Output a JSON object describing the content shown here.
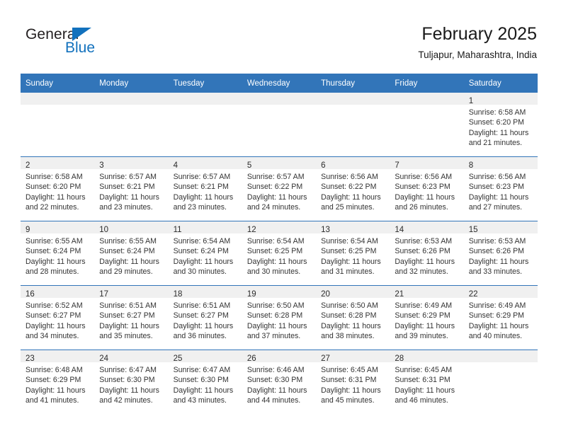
{
  "logo": {
    "word_one": "General",
    "word_two": "Blue",
    "triangle_icon": "triangle-icon",
    "accent_color": "#1271bd"
  },
  "header": {
    "title": "February 2025",
    "subtitle": "Tuljapur, Maharashtra, India",
    "header_bg_color": "#3275b9"
  },
  "calendar": {
    "weekday_headers": [
      "Sunday",
      "Monday",
      "Tuesday",
      "Wednesday",
      "Thursday",
      "Friday",
      "Saturday"
    ],
    "weeks": [
      [
        {
          "day": "",
          "lines": []
        },
        {
          "day": "",
          "lines": []
        },
        {
          "day": "",
          "lines": []
        },
        {
          "day": "",
          "lines": []
        },
        {
          "day": "",
          "lines": []
        },
        {
          "day": "",
          "lines": []
        },
        {
          "day": "1",
          "lines": [
            "Sunrise: 6:58 AM",
            "Sunset: 6:20 PM",
            "Daylight: 11 hours",
            "and 21 minutes."
          ]
        }
      ],
      [
        {
          "day": "2",
          "lines": [
            "Sunrise: 6:58 AM",
            "Sunset: 6:20 PM",
            "Daylight: 11 hours",
            "and 22 minutes."
          ]
        },
        {
          "day": "3",
          "lines": [
            "Sunrise: 6:57 AM",
            "Sunset: 6:21 PM",
            "Daylight: 11 hours",
            "and 23 minutes."
          ]
        },
        {
          "day": "4",
          "lines": [
            "Sunrise: 6:57 AM",
            "Sunset: 6:21 PM",
            "Daylight: 11 hours",
            "and 23 minutes."
          ]
        },
        {
          "day": "5",
          "lines": [
            "Sunrise: 6:57 AM",
            "Sunset: 6:22 PM",
            "Daylight: 11 hours",
            "and 24 minutes."
          ]
        },
        {
          "day": "6",
          "lines": [
            "Sunrise: 6:56 AM",
            "Sunset: 6:22 PM",
            "Daylight: 11 hours",
            "and 25 minutes."
          ]
        },
        {
          "day": "7",
          "lines": [
            "Sunrise: 6:56 AM",
            "Sunset: 6:23 PM",
            "Daylight: 11 hours",
            "and 26 minutes."
          ]
        },
        {
          "day": "8",
          "lines": [
            "Sunrise: 6:56 AM",
            "Sunset: 6:23 PM",
            "Daylight: 11 hours",
            "and 27 minutes."
          ]
        }
      ],
      [
        {
          "day": "9",
          "lines": [
            "Sunrise: 6:55 AM",
            "Sunset: 6:24 PM",
            "Daylight: 11 hours",
            "and 28 minutes."
          ]
        },
        {
          "day": "10",
          "lines": [
            "Sunrise: 6:55 AM",
            "Sunset: 6:24 PM",
            "Daylight: 11 hours",
            "and 29 minutes."
          ]
        },
        {
          "day": "11",
          "lines": [
            "Sunrise: 6:54 AM",
            "Sunset: 6:24 PM",
            "Daylight: 11 hours",
            "and 30 minutes."
          ]
        },
        {
          "day": "12",
          "lines": [
            "Sunrise: 6:54 AM",
            "Sunset: 6:25 PM",
            "Daylight: 11 hours",
            "and 30 minutes."
          ]
        },
        {
          "day": "13",
          "lines": [
            "Sunrise: 6:54 AM",
            "Sunset: 6:25 PM",
            "Daylight: 11 hours",
            "and 31 minutes."
          ]
        },
        {
          "day": "14",
          "lines": [
            "Sunrise: 6:53 AM",
            "Sunset: 6:26 PM",
            "Daylight: 11 hours",
            "and 32 minutes."
          ]
        },
        {
          "day": "15",
          "lines": [
            "Sunrise: 6:53 AM",
            "Sunset: 6:26 PM",
            "Daylight: 11 hours",
            "and 33 minutes."
          ]
        }
      ],
      [
        {
          "day": "16",
          "lines": [
            "Sunrise: 6:52 AM",
            "Sunset: 6:27 PM",
            "Daylight: 11 hours",
            "and 34 minutes."
          ]
        },
        {
          "day": "17",
          "lines": [
            "Sunrise: 6:51 AM",
            "Sunset: 6:27 PM",
            "Daylight: 11 hours",
            "and 35 minutes."
          ]
        },
        {
          "day": "18",
          "lines": [
            "Sunrise: 6:51 AM",
            "Sunset: 6:27 PM",
            "Daylight: 11 hours",
            "and 36 minutes."
          ]
        },
        {
          "day": "19",
          "lines": [
            "Sunrise: 6:50 AM",
            "Sunset: 6:28 PM",
            "Daylight: 11 hours",
            "and 37 minutes."
          ]
        },
        {
          "day": "20",
          "lines": [
            "Sunrise: 6:50 AM",
            "Sunset: 6:28 PM",
            "Daylight: 11 hours",
            "and 38 minutes."
          ]
        },
        {
          "day": "21",
          "lines": [
            "Sunrise: 6:49 AM",
            "Sunset: 6:29 PM",
            "Daylight: 11 hours",
            "and 39 minutes."
          ]
        },
        {
          "day": "22",
          "lines": [
            "Sunrise: 6:49 AM",
            "Sunset: 6:29 PM",
            "Daylight: 11 hours",
            "and 40 minutes."
          ]
        }
      ],
      [
        {
          "day": "23",
          "lines": [
            "Sunrise: 6:48 AM",
            "Sunset: 6:29 PM",
            "Daylight: 11 hours",
            "and 41 minutes."
          ]
        },
        {
          "day": "24",
          "lines": [
            "Sunrise: 6:47 AM",
            "Sunset: 6:30 PM",
            "Daylight: 11 hours",
            "and 42 minutes."
          ]
        },
        {
          "day": "25",
          "lines": [
            "Sunrise: 6:47 AM",
            "Sunset: 6:30 PM",
            "Daylight: 11 hours",
            "and 43 minutes."
          ]
        },
        {
          "day": "26",
          "lines": [
            "Sunrise: 6:46 AM",
            "Sunset: 6:30 PM",
            "Daylight: 11 hours",
            "and 44 minutes."
          ]
        },
        {
          "day": "27",
          "lines": [
            "Sunrise: 6:45 AM",
            "Sunset: 6:31 PM",
            "Daylight: 11 hours",
            "and 45 minutes."
          ]
        },
        {
          "day": "28",
          "lines": [
            "Sunrise: 6:45 AM",
            "Sunset: 6:31 PM",
            "Daylight: 11 hours",
            "and 46 minutes."
          ]
        },
        {
          "day": "",
          "lines": []
        }
      ]
    ]
  }
}
